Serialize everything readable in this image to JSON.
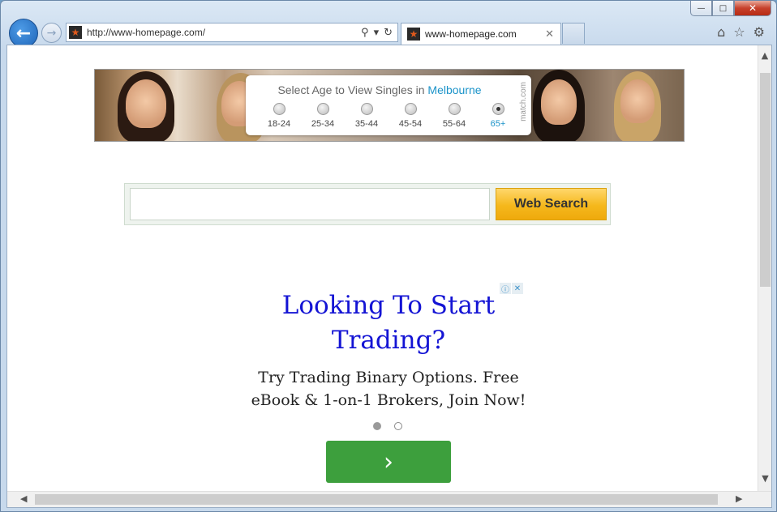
{
  "window": {
    "caption": {
      "minimize": "—",
      "maximize": "□",
      "close": "✕"
    }
  },
  "nav": {
    "back_icon": "arrow-left-icon",
    "forward_icon": "arrow-right-icon",
    "address": "http://www-homepage.com/",
    "address_icons": {
      "search": "⚲",
      "dropdown": "▾",
      "refresh": "↻"
    }
  },
  "tab": {
    "title": "www-homepage.com",
    "close": "✕"
  },
  "toolbar_icons": {
    "home": "⌂",
    "favorites": "☆",
    "tools": "⚙"
  },
  "banner": {
    "title_prefix": "Select Age to View Singles in ",
    "city": "Melbourne",
    "ages": [
      "18-24",
      "25-34",
      "35-44",
      "45-54",
      "55-64",
      "65+"
    ],
    "selected_age": "65+",
    "brand": "match.com"
  },
  "search": {
    "value": "",
    "placeholder": "",
    "button_label": "Web Search"
  },
  "ad": {
    "info_icon": "ⓘ",
    "close_icon": "✕",
    "headline": "Looking To Start Trading?",
    "body": "Try Trading Binary Options. Free eBook & 1-on-1 Brokers, Join Now!",
    "slides": 2,
    "active_slide": 1,
    "cta_icon": "›"
  },
  "scrollbars": {
    "up": "▲",
    "down": "▼",
    "left": "◀",
    "right": "▶"
  },
  "colors": {
    "link_blue": "#1414d4",
    "city_blue": "#1b93c9",
    "cta_green": "#3d9f3d",
    "search_button": "#f5b81c"
  }
}
